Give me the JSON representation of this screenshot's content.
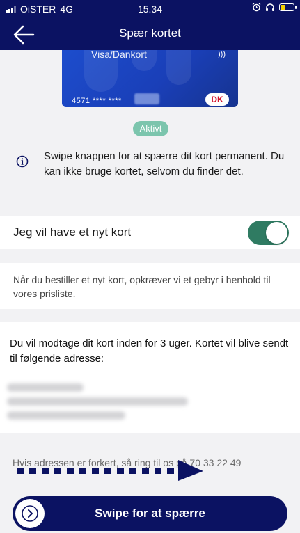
{
  "status_bar": {
    "carrier": "OiSTER",
    "network": "4G",
    "time": "15.34",
    "battery_level": 0.35
  },
  "nav": {
    "title": "Spær kortet",
    "back_icon": "arrow-left-icon"
  },
  "card": {
    "brand": "Visa/Dankort",
    "number_prefix": "4571 **** ****",
    "logo_text": "DK"
  },
  "status_badge": "Aktivt",
  "info": {
    "icon": "info-icon",
    "text": "Swipe knappen for at spærre dit kort permanent. Du kan ikke bruge kortet, selvom du finder det."
  },
  "new_card": {
    "label": "Jeg vil have et nyt kort",
    "enabled": true
  },
  "fee_notice": "Når du bestiller et nyt kort, opkræver vi et gebyr i henhold til vores prisliste.",
  "address": {
    "intro": "Du vil modtage dit kort inden for 3 uger. Kortet vil blive sendt til følgende adresse:"
  },
  "phone_notice": "Hvis adressen er forkert, så ring til os på 70 33 22 49",
  "swipe_button": {
    "label": "Swipe for at spærre",
    "icon": "chevron-right-icon"
  },
  "colors": {
    "navy": "#0b1262",
    "toggle_on": "#2f7b62",
    "badge": "#7cc5ad",
    "card_blue": "#1d4fd0"
  }
}
